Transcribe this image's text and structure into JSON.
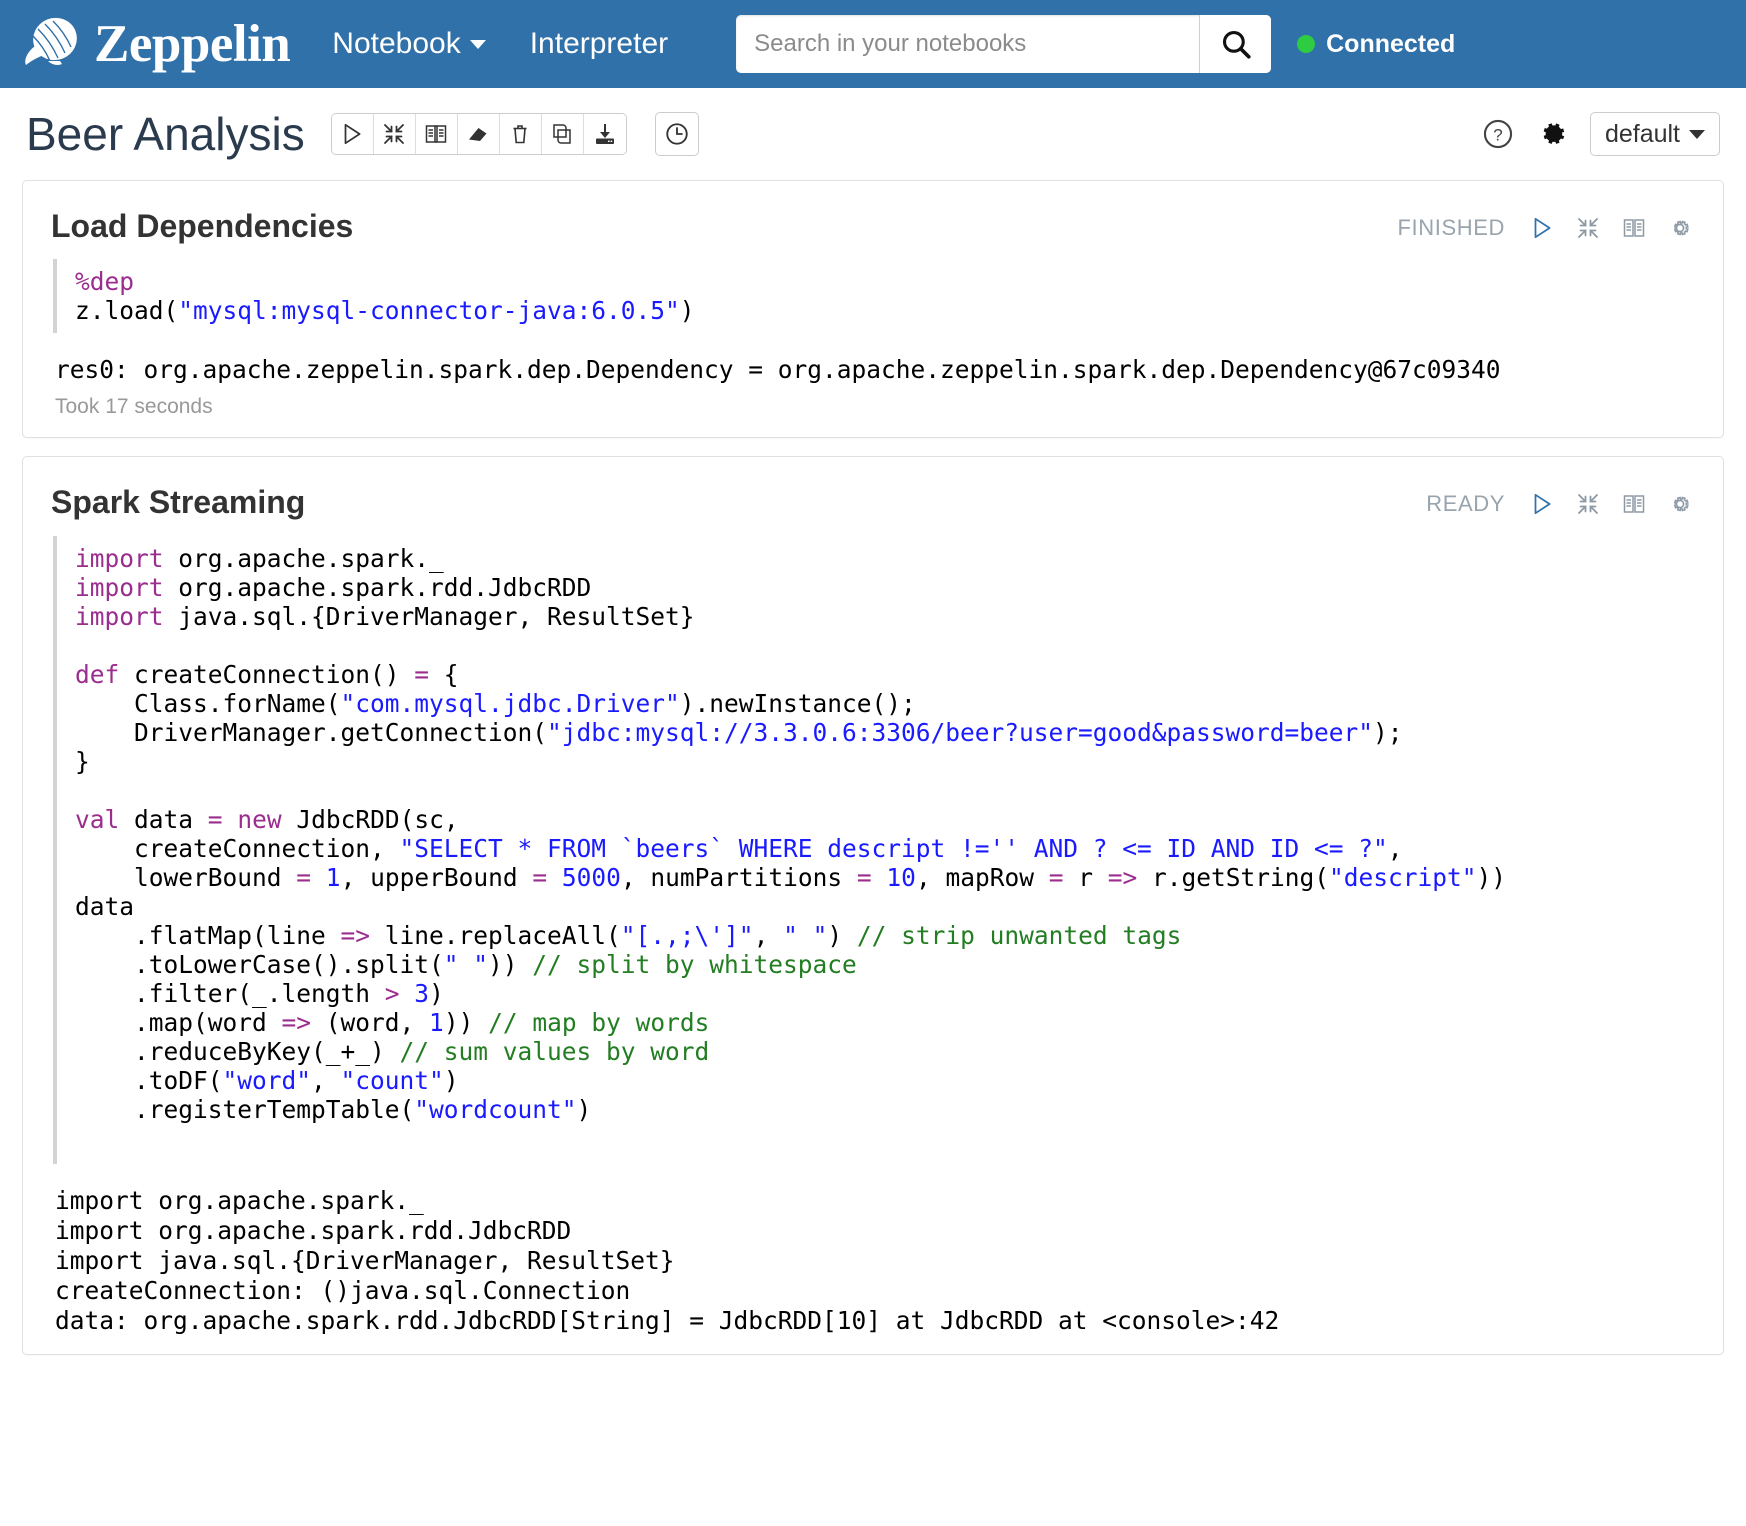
{
  "navbar": {
    "brand": "Zeppelin",
    "logo_icon": "zeppelin-airship-icon",
    "links": [
      {
        "label": "Notebook",
        "has_caret": true
      },
      {
        "label": "Interpreter",
        "has_caret": false
      }
    ],
    "search": {
      "placeholder": "Search in your notebooks",
      "value": "",
      "icon": "search-icon"
    },
    "connection": {
      "label": "Connected",
      "status_color": "#2ecc40"
    },
    "background_color": "#3071a9"
  },
  "note_header": {
    "title": "Beer Analysis",
    "toolbar": [
      {
        "name": "run-all-paragraphs",
        "icon": "play-icon"
      },
      {
        "name": "toggle-all-editors",
        "icon": "collapse-arrows-icon"
      },
      {
        "name": "toggle-all-output",
        "icon": "book-icon"
      },
      {
        "name": "clear-all-output",
        "icon": "eraser-icon"
      },
      {
        "name": "remove-notebook",
        "icon": "trash-icon"
      },
      {
        "name": "clone-notebook",
        "icon": "copy-icon"
      },
      {
        "name": "export-notebook",
        "icon": "download-icon"
      }
    ],
    "scheduler": {
      "name": "run-scheduler",
      "icon": "clock-icon"
    },
    "help": {
      "icon": "question-circle-icon"
    },
    "settings": {
      "icon": "gear-icon"
    },
    "interpreter_binding": {
      "selected": "default",
      "options": [
        "default"
      ]
    }
  },
  "paragraphs": [
    {
      "title": "Load Dependencies",
      "status": "FINISHED",
      "controls": [
        {
          "name": "run-paragraph",
          "icon": "play-icon"
        },
        {
          "name": "toggle-editor",
          "icon": "collapse-arrows-icon"
        },
        {
          "name": "toggle-output",
          "icon": "book-icon"
        },
        {
          "name": "paragraph-settings",
          "icon": "gear-icon"
        }
      ],
      "code_lines": [
        "%dep",
        "z.load(\"mysql:mysql-connector-java:6.0.5\")"
      ],
      "output": "res0: org.apache.zeppelin.spark.dep.Dependency = org.apache.zeppelin.spark.dep.Dependency@67c09340",
      "took": "Took 17 seconds"
    },
    {
      "title": "Spark Streaming",
      "status": "READY",
      "controls": [
        {
          "name": "run-paragraph",
          "icon": "play-icon"
        },
        {
          "name": "toggle-editor",
          "icon": "collapse-arrows-icon"
        },
        {
          "name": "toggle-output",
          "icon": "book-icon"
        },
        {
          "name": "paragraph-settings",
          "icon": "gear-icon"
        }
      ],
      "code_lines": [
        "import org.apache.spark._",
        "import org.apache.spark.rdd.JdbcRDD",
        "import java.sql.{DriverManager, ResultSet}",
        "",
        "def createConnection() = {",
        "    Class.forName(\"com.mysql.jdbc.Driver\").newInstance();",
        "    DriverManager.getConnection(\"jdbc:mysql://3.3.0.6:3306/beer?user=good&password=beer\");",
        "}",
        "",
        "val data = new JdbcRDD(sc,",
        "    createConnection, \"SELECT * FROM `beers` WHERE descript !='' AND ? <= ID AND ID <= ?\",",
        "    lowerBound = 1, upperBound = 5000, numPartitions = 10, mapRow = r => r.getString(\"descript\"))",
        "data",
        "    .flatMap(line => line.replaceAll(\"[.,;\\']\", \" \") // strip unwanted tags",
        "    .toLowerCase().split(\" \")) // split by whitespace",
        "    .filter(_.length > 3)",
        "    .map(word => (word, 1)) // map by words",
        "    .reduceByKey(_+_) // sum values by word",
        "    .toDF(\"word\", \"count\")",
        "    .registerTempTable(\"wordcount\")"
      ],
      "output_lines": [
        "import org.apache.spark._",
        "import org.apache.spark.rdd.JdbcRDD",
        "import java.sql.{DriverManager, ResultSet}",
        "createConnection: ()java.sql.Connection",
        "data: org.apache.spark.rdd.JdbcRDD[String] = JdbcRDD[10] at JdbcRDD at <console>:42"
      ]
    }
  ]
}
